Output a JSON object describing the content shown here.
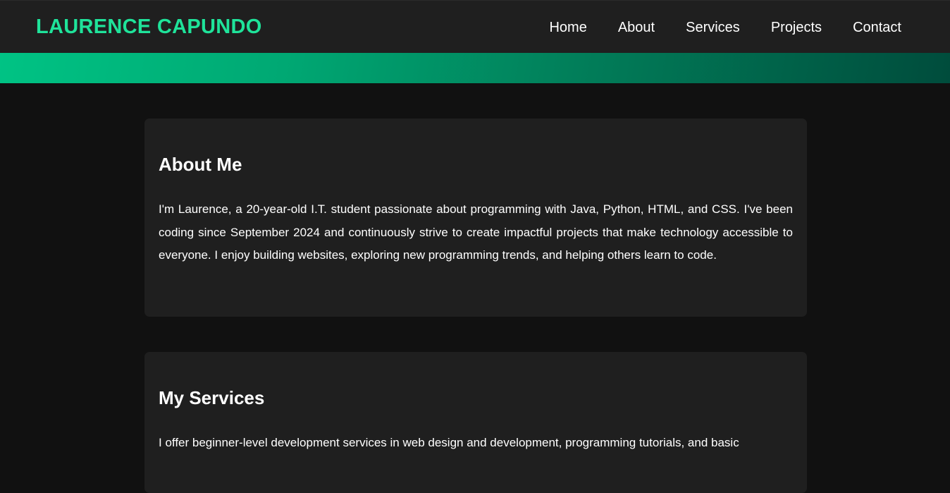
{
  "header": {
    "logo": "LAURENCE CAPUNDO",
    "nav": [
      {
        "label": "Home"
      },
      {
        "label": "About"
      },
      {
        "label": "Services"
      },
      {
        "label": "Projects"
      },
      {
        "label": "Contact"
      }
    ]
  },
  "colors": {
    "accent": "#1fe39a",
    "background": "#111111",
    "card": "#1f1f1f",
    "banner_start": "#00c384",
    "banner_end": "#004c3c"
  },
  "sections": {
    "about": {
      "title": "About Me",
      "text": "I'm Laurence, a 20-year-old I.T. student passionate about programming with Java, Python, HTML, and CSS. I've been coding since September 2024 and continuously strive to create impactful projects that make technology accessible to everyone. I enjoy building websites, exploring new programming trends, and helping others learn to code."
    },
    "services": {
      "title": "My Services",
      "text": "I offer beginner-level development services in web design and development, programming tutorials, and basic"
    }
  }
}
